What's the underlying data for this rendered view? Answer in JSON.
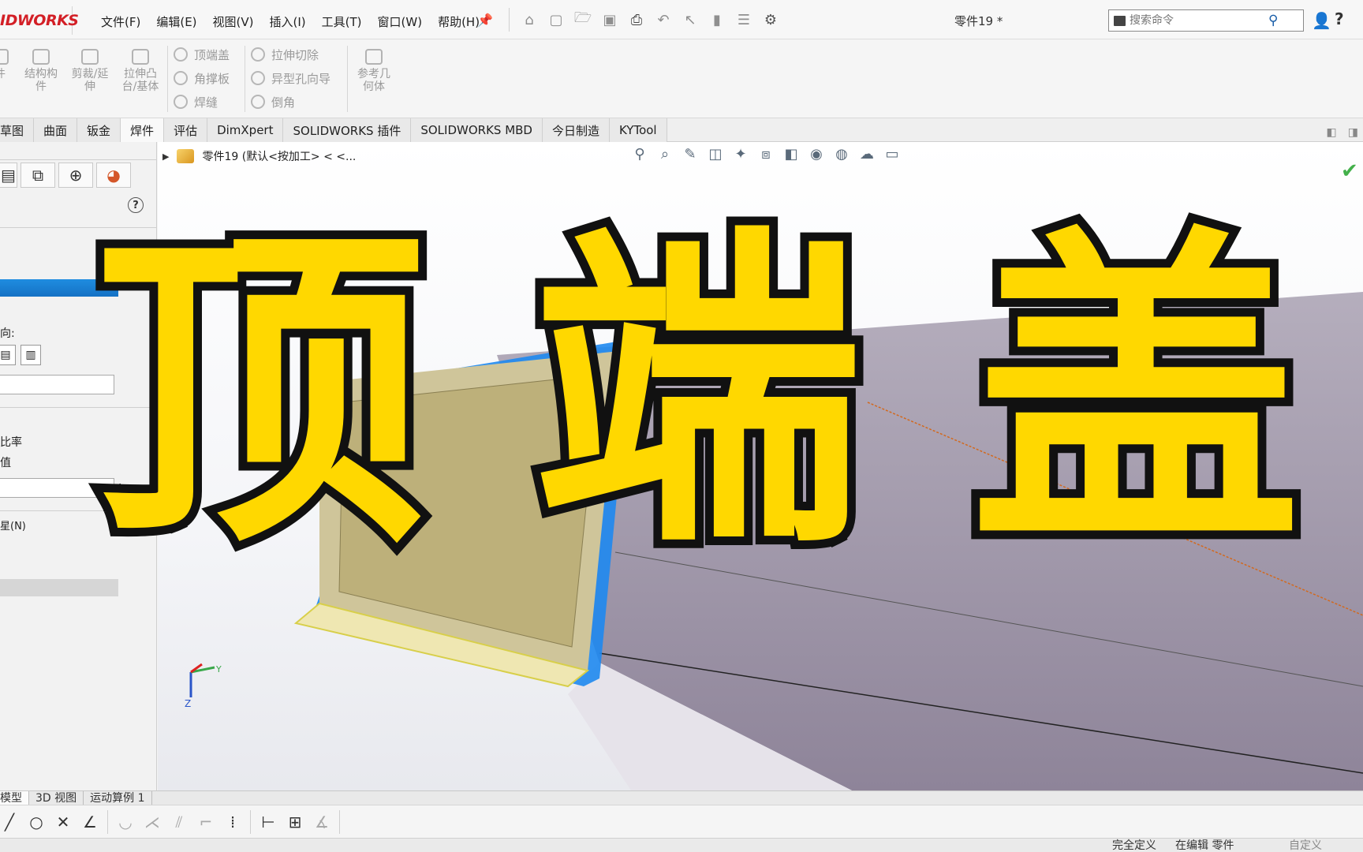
{
  "app": {
    "logo_text": "IDWORKS",
    "doc_title": "零件19 *",
    "pin_icon": "pin-icon"
  },
  "menu": [
    "文件(F)",
    "编辑(E)",
    "视图(V)",
    "插入(I)",
    "工具(T)",
    "窗口(W)",
    "帮助(H)"
  ],
  "search": {
    "placeholder": "搜索命令"
  },
  "ribbon": {
    "large_buttons": [
      {
        "label": "件",
        "icon": "part-icon"
      },
      {
        "label": "结构构\n件",
        "icon": "structural-member-icon"
      },
      {
        "label": "剪裁/延\n伸",
        "icon": "trim-extend-icon"
      },
      {
        "label": "拉伸凸\n台/基体",
        "icon": "extrude-boss-icon"
      }
    ],
    "small_col1": [
      "顶端盖",
      "角撑板",
      "焊缝"
    ],
    "small_col2": [
      "拉伸切除",
      "异型孔向导",
      "倒角"
    ],
    "ref_geometry": "参考几\n何体"
  },
  "tabs": {
    "items": [
      "草图",
      "曲面",
      "钣金",
      "焊件",
      "评估",
      "DimXpert",
      "SOLIDWORKS 插件",
      "SOLIDWORKS MBD",
      "今日制造",
      "KYTool"
    ],
    "active_index": 3
  },
  "left_panel": {
    "direction_label": "向:",
    "ratio_label": "比率",
    "value_label": "值",
    "n_label": "星(N)"
  },
  "viewport": {
    "breadcrumb": "零件19  (默认<按加工> < <..."
  },
  "overlay": {
    "chars": [
      "顶",
      "端",
      "盖"
    ]
  },
  "model_tabs": [
    "模型",
    "3D 视图",
    "运动算例 1"
  ],
  "statusbar": {
    "defined": "完全定义",
    "editing": "在编辑 零件",
    "custom": "自定义"
  },
  "colors": {
    "accent_blue": "#1571c4",
    "overlay_yellow": "#ffd800",
    "logo_red": "#d31f26",
    "tube_purple": "#9e93a8"
  }
}
